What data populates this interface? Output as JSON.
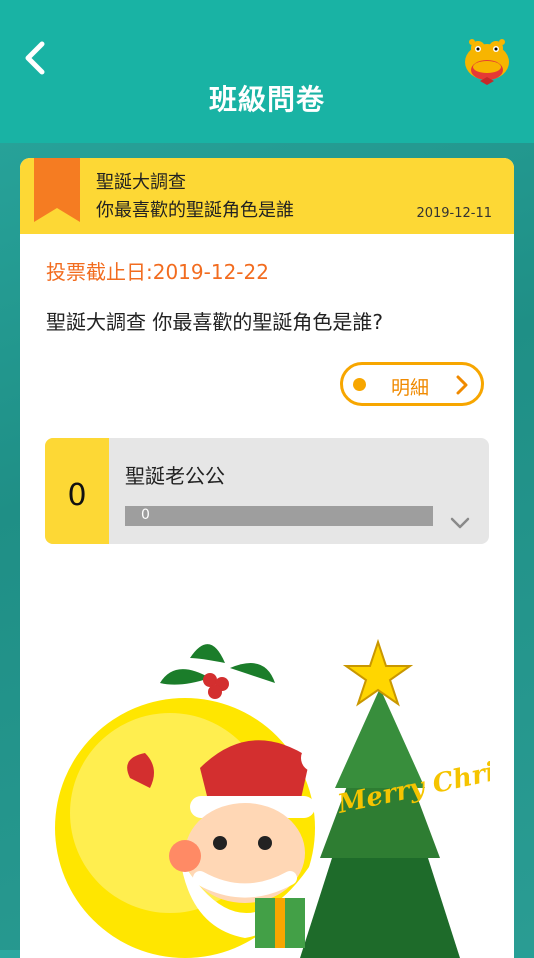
{
  "header": {
    "title": "班級問卷",
    "back_icon": "chevron-left-icon",
    "mascot_icon": "hippo-mascot-icon",
    "color": "#19b3a4"
  },
  "card": {
    "head": {
      "title": "聖誕大調查",
      "subtitle": "你最喜歡的聖誕角色是誰",
      "date": "2019-12-11",
      "bookmark_icon": "bookmark-icon",
      "color": "#fdd835"
    },
    "deadline": "投票截止日:2019-12-22",
    "question": "聖誕大調查 你最喜歡的聖誕角色是誰?",
    "detail_button": {
      "label": "明細",
      "color": "#f7a600"
    },
    "options": [
      {
        "count": "0",
        "label": "聖誕老公公",
        "bar_value": "0",
        "fraction": 0
      }
    ],
    "image": {
      "name": "christmas-illustration",
      "text": "Merry Christmas!"
    }
  }
}
